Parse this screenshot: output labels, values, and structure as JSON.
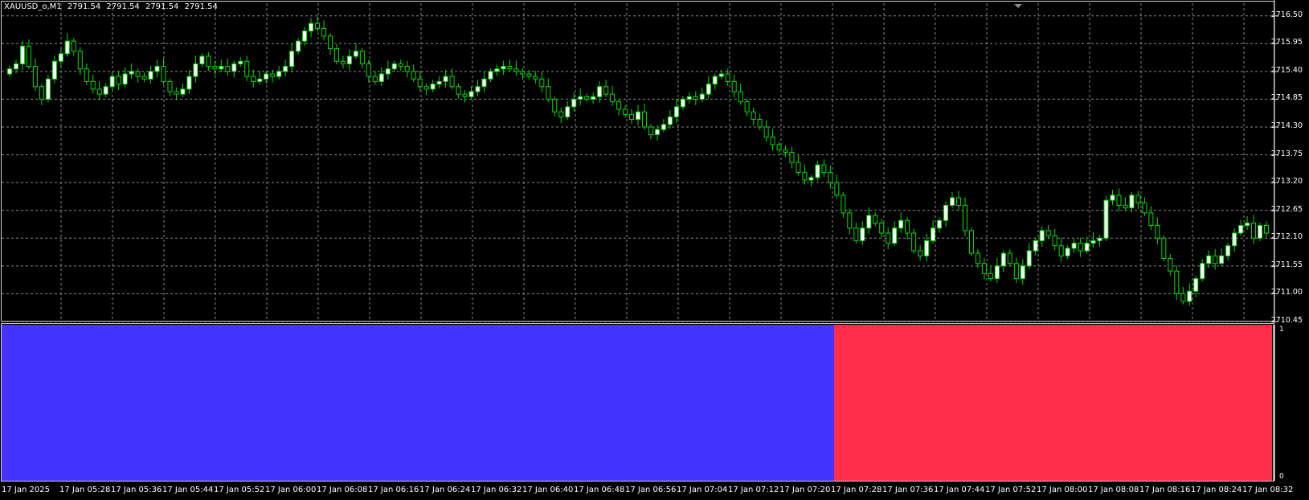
{
  "header": {
    "symbol": "XAUUSD_o,M1",
    "ohlc": [
      "2791.54",
      "2791.54",
      "2791.54",
      "2791.54"
    ]
  },
  "colors": {
    "background": "#000000",
    "grid": "#8a8a8a",
    "bull": "#ffffff",
    "wick": "#00e000",
    "indicator_blue": "#4533ff",
    "indicator_red": "#ff2d4a"
  },
  "indicator": {
    "top_label": "1",
    "bottom_label": "0",
    "segments": [
      {
        "state": "blue",
        "from": "17 Jan 2025",
        "to": "17 Jan 07:24"
      },
      {
        "state": "red",
        "from": "17 Jan 07:24",
        "to": "17 Jan 08:32"
      }
    ]
  },
  "chart_data": {
    "type": "candlestick",
    "title": "XAUUSD_o,M1",
    "y_ticks": [
      "2716.50",
      "2715.95",
      "2715.40",
      "2714.85",
      "2714.30",
      "2713.75",
      "2713.20",
      "2712.65",
      "2712.10",
      "2711.55",
      "2711.00",
      "2710.45"
    ],
    "ylim": [
      2710.45,
      2716.75
    ],
    "x_ticks": [
      "17 Jan 2025",
      "17 Jan 05:28",
      "17 Jan 05:36",
      "17 Jan 05:44",
      "17 Jan 05:52",
      "17 Jan 06:00",
      "17 Jan 06:08",
      "17 Jan 06:16",
      "17 Jan 06:24",
      "17 Jan 06:32",
      "17 Jan 06:40",
      "17 Jan 06:48",
      "17 Jan 06:56",
      "17 Jan 07:04",
      "17 Jan 07:12",
      "17 Jan 07:20",
      "17 Jan 07:28",
      "17 Jan 07:36",
      "17 Jan 07:44",
      "17 Jan 07:52",
      "17 Jan 08:00",
      "17 Jan 08:08",
      "17 Jan 08:16",
      "17 Jan 08:24",
      "17 Jan 08:32"
    ],
    "grid": true,
    "close": [
      2715.45,
      2715.55,
      2715.9,
      2715.5,
      2715.1,
      2714.85,
      2715.25,
      2715.6,
      2715.75,
      2716.0,
      2715.8,
      2715.45,
      2715.2,
      2715.05,
      2714.95,
      2715.1,
      2715.3,
      2715.15,
      2715.35,
      2715.4,
      2715.3,
      2715.25,
      2715.4,
      2715.5,
      2715.2,
      2715.0,
      2714.95,
      2715.05,
      2715.3,
      2715.55,
      2715.7,
      2715.5,
      2715.45,
      2715.5,
      2715.4,
      2715.55,
      2715.6,
      2715.3,
      2715.2,
      2715.25,
      2715.35,
      2715.3,
      2715.4,
      2715.5,
      2715.8,
      2716.0,
      2716.2,
      2716.35,
      2716.25,
      2716.1,
      2715.85,
      2715.6,
      2715.55,
      2715.7,
      2715.8,
      2715.55,
      2715.3,
      2715.2,
      2715.35,
      2715.45,
      2715.55,
      2715.5,
      2715.4,
      2715.25,
      2715.1,
      2715.05,
      2715.15,
      2715.2,
      2715.3,
      2715.1,
      2714.95,
      2714.9,
      2715.0,
      2715.1,
      2715.25,
      2715.4,
      2715.45,
      2715.5,
      2715.45,
      2715.4,
      2715.35,
      2715.3,
      2715.25,
      2715.1,
      2714.85,
      2714.6,
      2714.5,
      2714.7,
      2714.85,
      2714.9,
      2714.85,
      2714.9,
      2715.1,
      2714.95,
      2714.8,
      2714.65,
      2714.55,
      2714.45,
      2714.6,
      2714.3,
      2714.15,
      2714.25,
      2714.35,
      2714.5,
      2714.7,
      2714.85,
      2714.9,
      2714.85,
      2714.95,
      2715.15,
      2715.3,
      2715.35,
      2715.2,
      2715.0,
      2714.8,
      2714.6,
      2714.45,
      2714.3,
      2714.1,
      2713.95,
      2713.85,
      2713.8,
      2713.6,
      2713.4,
      2713.25,
      2713.3,
      2713.55,
      2713.4,
      2713.2,
      2712.95,
      2712.6,
      2712.3,
      2712.05,
      2712.3,
      2712.55,
      2712.4,
      2712.2,
      2712.0,
      2712.3,
      2712.45,
      2712.2,
      2711.85,
      2711.75,
      2712.05,
      2712.3,
      2712.45,
      2712.75,
      2712.9,
      2712.75,
      2712.25,
      2711.8,
      2711.6,
      2711.4,
      2711.3,
      2711.55,
      2711.8,
      2711.6,
      2711.3,
      2711.55,
      2711.85,
      2712.05,
      2712.25,
      2712.15,
      2711.95,
      2711.75,
      2711.9,
      2712.0,
      2711.85,
      2712.0,
      2712.05,
      2712.1,
      2712.85,
      2712.95,
      2712.75,
      2712.7,
      2712.95,
      2712.8,
      2712.6,
      2712.35,
      2712.1,
      2711.7,
      2711.45,
      2711.0,
      2710.85,
      2711.05,
      2711.3,
      2711.6,
      2711.75,
      2711.6,
      2711.75,
      2711.95,
      2712.2,
      2712.35,
      2712.4,
      2712.1,
      2712.35,
      2712.2
    ]
  }
}
